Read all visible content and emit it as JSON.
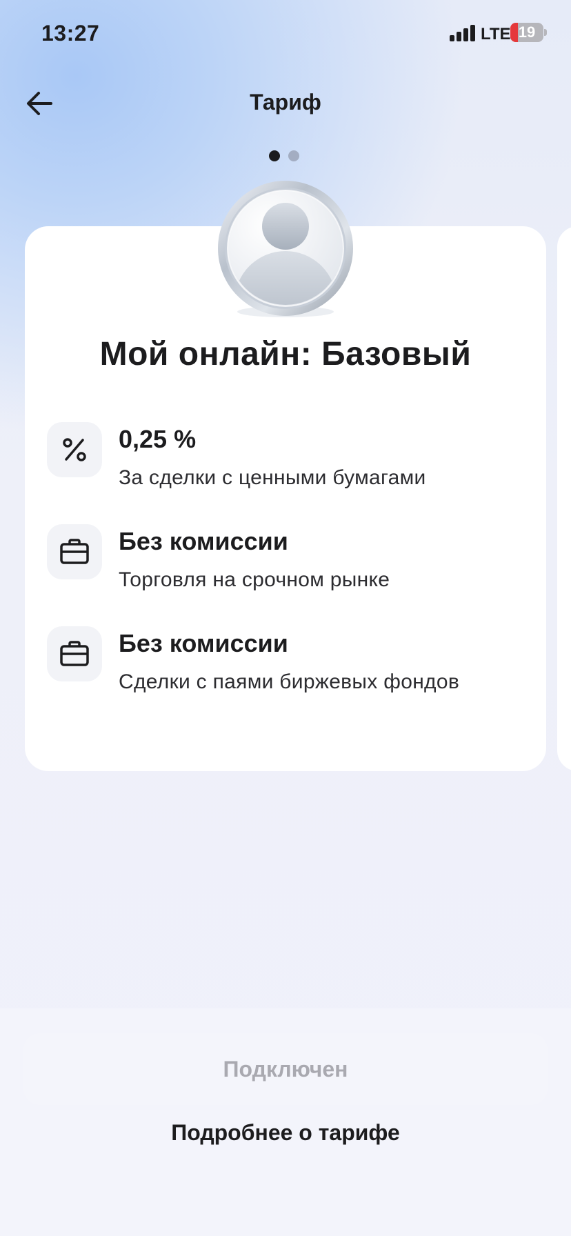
{
  "status_bar": {
    "time": "13:27",
    "network": "LTE",
    "battery_level": "19"
  },
  "header": {
    "title": "Тариф",
    "back_icon": "arrow-left-icon"
  },
  "pager": {
    "total": 2,
    "active_index": 0,
    "colors": {
      "active": "#1c1c1e",
      "inactive": "#a3adc2"
    }
  },
  "card": {
    "avatar_icon": "user-avatar-icon",
    "title": "Мой онлайн: Базовый",
    "features": [
      {
        "icon": "percent-icon",
        "title": "0,25 %",
        "description": "За сделки с ценными бумагами"
      },
      {
        "icon": "briefcase-icon",
        "title": "Без комиссии",
        "description": "Торговля на срочном рынке"
      },
      {
        "icon": "briefcase-icon",
        "title": "Без комиссии",
        "description": "Сделки с паями биржевых фондов"
      }
    ]
  },
  "actions": {
    "connected_label": "Подключен",
    "details_label": "Подробнее о тарифе"
  },
  "colors": {
    "background_gradient_accent": "#a9c8f6",
    "card": "#ffffff",
    "text": "#1c1c1e",
    "disabled_text": "#a9a9b0",
    "battery_low": "#e5383b"
  }
}
